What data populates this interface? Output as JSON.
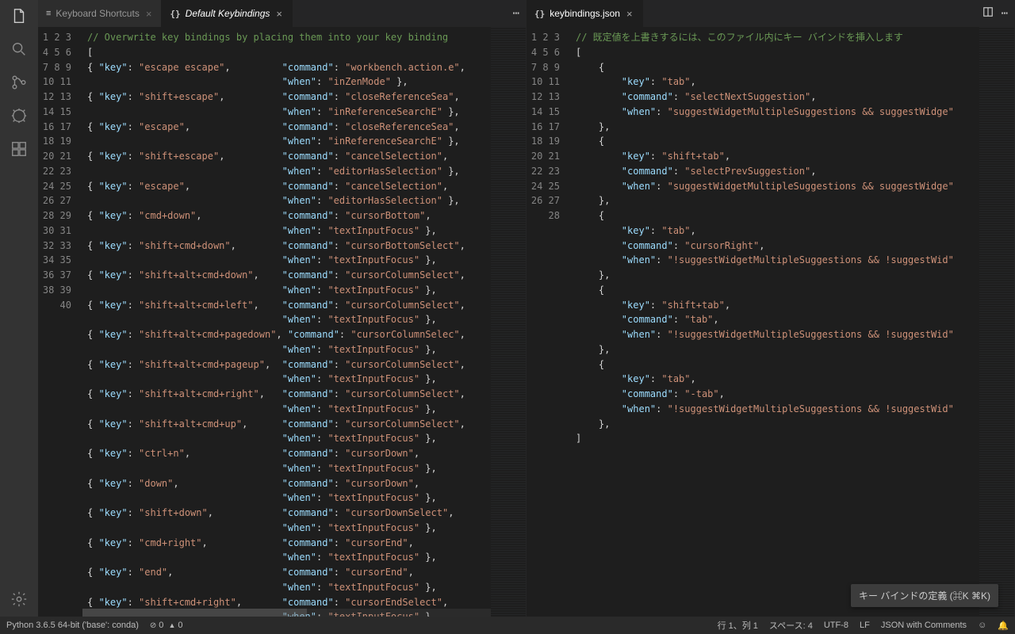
{
  "activitybar": {
    "items": [
      "files",
      "search",
      "scm",
      "debug",
      "extensions"
    ],
    "bottom": "settings"
  },
  "leftPane": {
    "tabs": [
      {
        "icon": "≡",
        "label": "Keyboard Shortcuts",
        "active": false
      },
      {
        "icon": "{}",
        "label": "Default Keybindings",
        "active": true,
        "italic": true
      }
    ],
    "code": [
      {
        "n": 1,
        "kind": "comment",
        "text": "// Overwrite key bindings by placing them into your key binding"
      },
      {
        "n": 2,
        "kind": "punct",
        "text": "["
      },
      {
        "n": 3,
        "kind": "kv",
        "pairs": [
          [
            "key",
            "escape escape"
          ],
          [
            "command",
            "workbench.action.e"
          ]
        ],
        "open": true
      },
      {
        "n": 4,
        "kind": "kvc",
        "pairs": [
          [
            "when",
            "inZenMode"
          ]
        ]
      },
      {
        "n": 5,
        "kind": "kv",
        "pairs": [
          [
            "key",
            "shift+escape"
          ],
          [
            "command",
            "closeReferenceSea"
          ]
        ],
        "open": true
      },
      {
        "n": 6,
        "kind": "kvc",
        "pairs": [
          [
            "when",
            "inReferenceSearchE"
          ]
        ]
      },
      {
        "n": 7,
        "kind": "kv",
        "pairs": [
          [
            "key",
            "escape"
          ],
          [
            "command",
            "closeReferenceSea"
          ]
        ],
        "open": true
      },
      {
        "n": 8,
        "kind": "kvc",
        "pairs": [
          [
            "when",
            "inReferenceSearchE"
          ]
        ]
      },
      {
        "n": 9,
        "kind": "kv",
        "pairs": [
          [
            "key",
            "shift+escape"
          ],
          [
            "command",
            "cancelSelection"
          ]
        ],
        "open": true
      },
      {
        "n": 10,
        "kind": "kvc",
        "pairs": [
          [
            "when",
            "editorHasSelection"
          ]
        ]
      },
      {
        "n": 11,
        "kind": "kv",
        "pairs": [
          [
            "key",
            "escape"
          ],
          [
            "command",
            "cancelSelection"
          ]
        ],
        "open": true
      },
      {
        "n": 12,
        "kind": "kvc",
        "pairs": [
          [
            "when",
            "editorHasSelection"
          ]
        ]
      },
      {
        "n": 13,
        "kind": "kv",
        "pairs": [
          [
            "key",
            "cmd+down"
          ],
          [
            "command",
            "cursorBottom"
          ]
        ],
        "open": true
      },
      {
        "n": 14,
        "kind": "kvc",
        "pairs": [
          [
            "when",
            "textInputFocus"
          ]
        ]
      },
      {
        "n": 15,
        "kind": "kv",
        "pairs": [
          [
            "key",
            "shift+cmd+down"
          ],
          [
            "command",
            "cursorBottomSelect"
          ]
        ],
        "open": true
      },
      {
        "n": 16,
        "kind": "kvc",
        "pairs": [
          [
            "when",
            "textInputFocus"
          ]
        ]
      },
      {
        "n": 17,
        "kind": "kv",
        "pairs": [
          [
            "key",
            "shift+alt+cmd+down"
          ],
          [
            "command",
            "cursorColumnSelect"
          ]
        ],
        "open": true
      },
      {
        "n": 18,
        "kind": "kvc",
        "pairs": [
          [
            "when",
            "textInputFocus"
          ]
        ]
      },
      {
        "n": 19,
        "kind": "kv",
        "pairs": [
          [
            "key",
            "shift+alt+cmd+left"
          ],
          [
            "command",
            "cursorColumnSelect"
          ]
        ],
        "open": true
      },
      {
        "n": 20,
        "kind": "kvc",
        "pairs": [
          [
            "when",
            "textInputFocus"
          ]
        ]
      },
      {
        "n": 21,
        "kind": "kv",
        "pairs": [
          [
            "key",
            "shift+alt+cmd+pagedown"
          ],
          [
            "command",
            "cursorColumnSelec"
          ]
        ],
        "open": true
      },
      {
        "n": 22,
        "kind": "kvc",
        "pairs": [
          [
            "when",
            "textInputFocus"
          ]
        ]
      },
      {
        "n": 23,
        "kind": "kv",
        "pairs": [
          [
            "key",
            "shift+alt+cmd+pageup"
          ],
          [
            "command",
            "cursorColumnSelect"
          ]
        ],
        "open": true
      },
      {
        "n": 24,
        "kind": "kvc",
        "pairs": [
          [
            "when",
            "textInputFocus"
          ]
        ]
      },
      {
        "n": 25,
        "kind": "kv",
        "pairs": [
          [
            "key",
            "shift+alt+cmd+right"
          ],
          [
            "command",
            "cursorColumnSelect"
          ]
        ],
        "open": true
      },
      {
        "n": 26,
        "kind": "kvc",
        "pairs": [
          [
            "when",
            "textInputFocus"
          ]
        ]
      },
      {
        "n": 27,
        "kind": "kv",
        "pairs": [
          [
            "key",
            "shift+alt+cmd+up"
          ],
          [
            "command",
            "cursorColumnSelect"
          ]
        ],
        "open": true
      },
      {
        "n": 28,
        "kind": "kvc",
        "pairs": [
          [
            "when",
            "textInputFocus"
          ]
        ]
      },
      {
        "n": 29,
        "kind": "kv",
        "pairs": [
          [
            "key",
            "ctrl+n"
          ],
          [
            "command",
            "cursorDown"
          ]
        ],
        "open": true
      },
      {
        "n": 30,
        "kind": "kvc",
        "pairs": [
          [
            "when",
            "textInputFocus"
          ]
        ]
      },
      {
        "n": 31,
        "kind": "kv",
        "pairs": [
          [
            "key",
            "down"
          ],
          [
            "command",
            "cursorDown"
          ]
        ],
        "open": true
      },
      {
        "n": 32,
        "kind": "kvc",
        "pairs": [
          [
            "when",
            "textInputFocus"
          ]
        ]
      },
      {
        "n": 33,
        "kind": "kv",
        "pairs": [
          [
            "key",
            "shift+down"
          ],
          [
            "command",
            "cursorDownSelect"
          ]
        ],
        "open": true
      },
      {
        "n": 34,
        "kind": "kvc",
        "pairs": [
          [
            "when",
            "textInputFocus"
          ]
        ]
      },
      {
        "n": 35,
        "kind": "kv",
        "pairs": [
          [
            "key",
            "cmd+right"
          ],
          [
            "command",
            "cursorEnd"
          ]
        ],
        "open": true
      },
      {
        "n": 36,
        "kind": "kvc",
        "pairs": [
          [
            "when",
            "textInputFocus"
          ]
        ]
      },
      {
        "n": 37,
        "kind": "kv",
        "pairs": [
          [
            "key",
            "end"
          ],
          [
            "command",
            "cursorEnd"
          ]
        ],
        "open": true
      },
      {
        "n": 38,
        "kind": "kvc",
        "pairs": [
          [
            "when",
            "textInputFocus"
          ]
        ]
      },
      {
        "n": 39,
        "kind": "kv",
        "pairs": [
          [
            "key",
            "shift+cmd+right"
          ],
          [
            "command",
            "cursorEndSelect"
          ]
        ],
        "open": true
      },
      {
        "n": 40,
        "kind": "kvc",
        "pairs": [
          [
            "when",
            "textInputFocus"
          ]
        ]
      }
    ]
  },
  "rightPane": {
    "tabs": [
      {
        "icon": "{}",
        "label": "keybindings.json",
        "active": true
      }
    ],
    "hint_label": "キー バインドの定義 (⌘K ⌘K)",
    "code": [
      {
        "n": 1,
        "kind": "comment",
        "text": "// 既定値を上書きするには、このファイル内にキー バインドを挿入します"
      },
      {
        "n": 2,
        "kind": "punct",
        "text": "["
      },
      {
        "n": 3,
        "kind": "obrace"
      },
      {
        "n": 4,
        "kind": "prop",
        "k": "key",
        "v": "tab"
      },
      {
        "n": 5,
        "kind": "prop",
        "k": "command",
        "v": "selectNextSuggestion"
      },
      {
        "n": 6,
        "kind": "prop",
        "k": "when",
        "v": "suggestWidgetMultipleSuggestions && suggestWidge",
        "last": true
      },
      {
        "n": 7,
        "kind": "cbrace"
      },
      {
        "n": 8,
        "kind": "obrace"
      },
      {
        "n": 9,
        "kind": "prop",
        "k": "key",
        "v": "shift+tab"
      },
      {
        "n": 10,
        "kind": "prop",
        "k": "command",
        "v": "selectPrevSuggestion"
      },
      {
        "n": 11,
        "kind": "prop",
        "k": "when",
        "v": "suggestWidgetMultipleSuggestions && suggestWidge",
        "last": true
      },
      {
        "n": 12,
        "kind": "cbrace"
      },
      {
        "n": 13,
        "kind": "obrace"
      },
      {
        "n": 14,
        "kind": "prop",
        "k": "key",
        "v": "tab"
      },
      {
        "n": 15,
        "kind": "prop",
        "k": "command",
        "v": "cursorRight"
      },
      {
        "n": 16,
        "kind": "prop",
        "k": "when",
        "v": "!suggestWidgetMultipleSuggestions && !suggestWid",
        "last": true
      },
      {
        "n": 17,
        "kind": "cbrace"
      },
      {
        "n": 18,
        "kind": "obrace"
      },
      {
        "n": 19,
        "kind": "prop",
        "k": "key",
        "v": "shift+tab"
      },
      {
        "n": 20,
        "kind": "prop",
        "k": "command",
        "v": "tab"
      },
      {
        "n": 21,
        "kind": "prop",
        "k": "when",
        "v": "!suggestWidgetMultipleSuggestions && !suggestWid",
        "last": true
      },
      {
        "n": 22,
        "kind": "cbrace"
      },
      {
        "n": 23,
        "kind": "obrace"
      },
      {
        "n": 24,
        "kind": "prop",
        "k": "key",
        "v": "tab"
      },
      {
        "n": 25,
        "kind": "prop",
        "k": "command",
        "v": "-tab"
      },
      {
        "n": 26,
        "kind": "prop",
        "k": "when",
        "v": "!suggestWidgetMultipleSuggestions && !suggestWid",
        "last": true
      },
      {
        "n": 27,
        "kind": "cbrace"
      },
      {
        "n": 28,
        "kind": "punct",
        "text": "]"
      }
    ]
  },
  "statusbar": {
    "python": "Python 3.6.5 64-bit ('base': conda)",
    "errors": "0",
    "warnings": "0",
    "lncol": "行 1、列 1",
    "spaces": "スペース: 4",
    "encoding": "UTF-8",
    "eol": "LF",
    "lang": "JSON with Comments"
  }
}
